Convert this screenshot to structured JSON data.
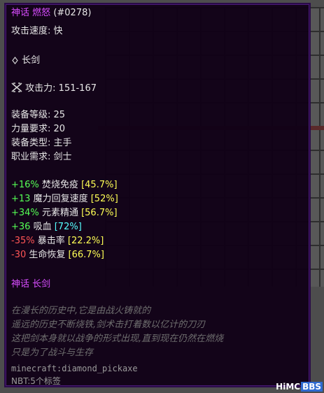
{
  "tooltip": {
    "title_rarity": "神话",
    "title_name": "燃怒",
    "title_id": "(#0278)",
    "attack_speed_label": "攻击速度:",
    "attack_speed_value": "快",
    "weapon_type": "长剑",
    "attack_label": "攻击力:",
    "attack_value": "151-167",
    "equip_level_label": "装备等级:",
    "equip_level_value": "25",
    "strength_req_label": "力量要求:",
    "strength_req_value": "20",
    "equip_type_label": "装备类型:",
    "equip_type_value": "主手",
    "class_req_label": "职业需求:",
    "class_req_value": "剑士",
    "stats": [
      {
        "value": "+16%",
        "name": "焚烧免疫",
        "pct": "[45.7%]"
      },
      {
        "value": "+13",
        "name": "魔力回复速度",
        "pct": "[52%]"
      },
      {
        "value": "+34%",
        "name": "元素精通",
        "pct": "[56.7%]"
      },
      {
        "value": "+36",
        "name": "吸血",
        "pct": "[72%]"
      },
      {
        "value": "-35%",
        "name": "暴击率",
        "pct": "[22.2%]"
      },
      {
        "value": "-30",
        "name": "生命恢复",
        "pct": "[66.7%]"
      }
    ],
    "rarity_type": "神话 长剑",
    "lore": [
      "在漫长的历史中,它是由战火铸就的",
      "遥远的历史不断烧铁,剑术击打着数以亿计的刀刃",
      "这把剑本身就以战争的形式出现,直到现在仍然在燃烧",
      "只是为了战斗与生存"
    ],
    "item_id": "minecraft:diamond_pickaxe",
    "nbt": "NBT:5个标签"
  },
  "watermark": {
    "left": "HiMC",
    "right": "BBS"
  },
  "colors": {
    "background": "#100016",
    "border": "#2a0b48",
    "mythic": "#d84dff",
    "positive": "#55ff55",
    "negative": "#ff5555",
    "roll_yellow": "#ffff55",
    "roll_aqua": "#55ffff"
  },
  "icons": [
    "sword-icon",
    "crossed-swords-icon"
  ]
}
